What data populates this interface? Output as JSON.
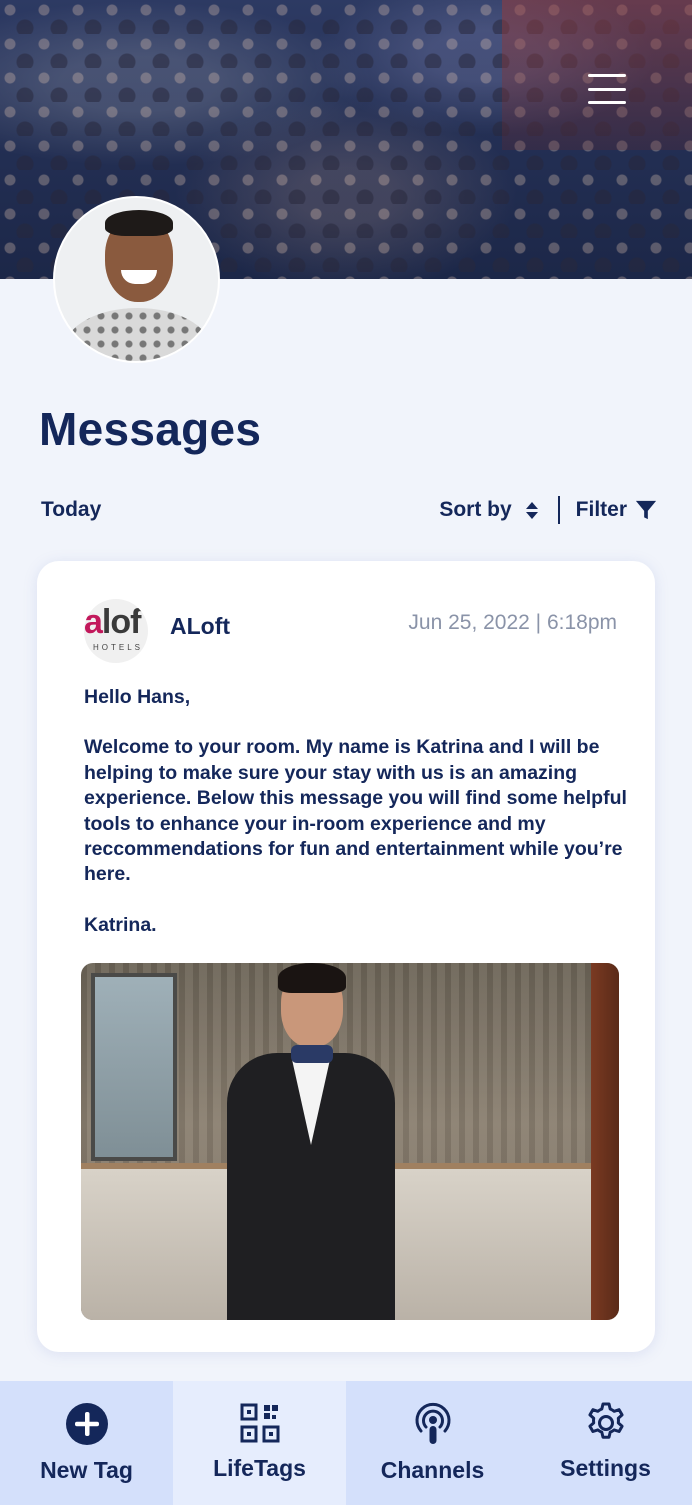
{
  "header": {
    "background_image": "crowd-photo",
    "menu_icon": "hamburger-menu-icon"
  },
  "profile": {
    "avatar": "user-avatar-photo"
  },
  "page": {
    "title": "Messages"
  },
  "toolbar": {
    "today_label": "Today",
    "sort_label": "Sort by",
    "filter_label": "Filter"
  },
  "message": {
    "sender": "ALoft",
    "logo_text": "aloft",
    "logo_sub": "HOTELS",
    "date": "Jun 25, 2022 | 6:18pm",
    "greeting": "Hello Hans,",
    "body": "Welcome to your room. My name is Katrina and I will be helping to make sure your stay with us is an amazing experience. Below this message you will find some helpful tools to enhance your in-room experience and my reccommendations for fun and entertainment while you’re here.",
    "signature": "Katrina.",
    "image": "hotel-concierge-photo"
  },
  "nav": {
    "items": [
      {
        "label": "New Tag",
        "icon": "plus-circle-icon"
      },
      {
        "label": "LifeTags",
        "icon": "qr-code-icon"
      },
      {
        "label": "Channels",
        "icon": "podcast-icon"
      },
      {
        "label": "Settings",
        "icon": "gear-icon"
      }
    ]
  },
  "colors": {
    "primary": "#14275a",
    "background": "#f1f4fb",
    "nav_background": "#d4e0fb",
    "nav_active": "#e6edfd",
    "muted_text": "#8a93a8"
  }
}
